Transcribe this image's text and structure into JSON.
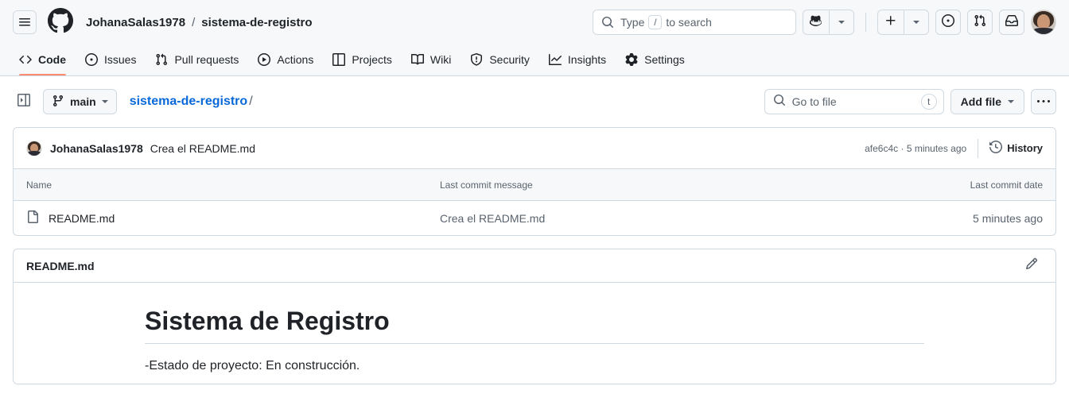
{
  "header": {
    "hamburger_label": "menu-toggle",
    "logo_label": "GitHub",
    "owner": "JohanaSalas1978",
    "separator": "/",
    "repo": "sistema-de-registro",
    "search": {
      "placeholder_prefix": "Type",
      "kbd": "/",
      "placeholder_suffix": "to search",
      "icon": "search-icon"
    },
    "copilot_button": "copilot-icon",
    "copilot_caret": "chevron-down-icon",
    "create_new": "plus-icon",
    "create_new_caret": "chevron-down-icon",
    "issues_button": "issue-opened-icon",
    "pull_requests_button": "git-pull-request-icon",
    "inbox_button": "inbox-icon",
    "avatar": "user-avatar"
  },
  "repo_nav": {
    "tabs": [
      {
        "label": "Code",
        "icon": "code-icon",
        "active": true
      },
      {
        "label": "Issues",
        "icon": "issue-opened-icon",
        "active": false
      },
      {
        "label": "Pull requests",
        "icon": "git-pull-request-icon",
        "active": false
      },
      {
        "label": "Actions",
        "icon": "play-icon",
        "active": false
      },
      {
        "label": "Projects",
        "icon": "table-icon",
        "active": false
      },
      {
        "label": "Wiki",
        "icon": "book-icon",
        "active": false
      },
      {
        "label": "Security",
        "icon": "shield-icon",
        "active": false
      },
      {
        "label": "Insights",
        "icon": "graph-icon",
        "active": false
      },
      {
        "label": "Settings",
        "icon": "gear-icon",
        "active": false
      }
    ],
    "active_underline_color": "#fd8c73"
  },
  "file_nav": {
    "sidebar_toggle": "sidebar-expand-icon",
    "branch": "main",
    "branch_icon": "git-branch-icon",
    "branch_caret": "chevron-down-icon",
    "breadcrumb_repo": "sistema-de-registro",
    "breadcrumb_slash": "/",
    "go_to_file_placeholder": "Go to file",
    "go_to_file_icon": "search-icon",
    "go_to_file_kbd": "t",
    "add_file_label": "Add file",
    "add_file_caret": "chevron-down-icon",
    "more_options": "…"
  },
  "commit": {
    "author": "JohanaSalas1978",
    "message": "Crea el README.md",
    "sha": "afe6c4c",
    "separator": "·",
    "relative_time": "5 minutes ago",
    "history_label": "History",
    "history_icon": "history-icon"
  },
  "file_table": {
    "columns": {
      "name": "Name",
      "message": "Last commit message",
      "date": "Last commit date"
    },
    "rows": [
      {
        "icon": "file-icon",
        "name": "README.md",
        "message": "Crea el README.md",
        "date": "5 minutes ago"
      }
    ]
  },
  "readme": {
    "title": "README.md",
    "edit_icon": "pencil-icon",
    "heading": "Sistema de Registro",
    "paragraph": "-Estado de proyecto: En construcción."
  },
  "colors": {
    "accent_link": "#0969da",
    "active_tab_underline": "#fd8c73",
    "border": "#d1d9e0",
    "surface_muted": "#f6f8fa",
    "text_primary": "#1f2328",
    "text_muted": "#59636e"
  }
}
